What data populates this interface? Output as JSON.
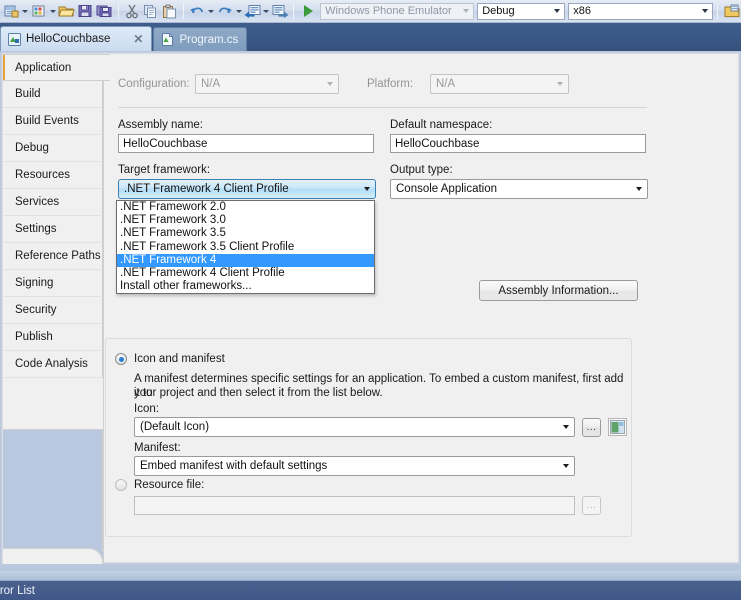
{
  "toolbar": {
    "icons": [
      "new-project-icon",
      "new-item-icon",
      "open-file-icon",
      "save-icon",
      "save-all-icon",
      "cut-icon",
      "copy-icon",
      "paste-icon",
      "undo-icon",
      "redo-icon",
      "navigate-backward-icon",
      "navigate-forward-icon",
      "start-debugging-icon",
      "solution-explorer-icon"
    ],
    "target_device": {
      "value": "Windows Phone Emulator",
      "disabled": true
    },
    "configuration": {
      "value": "Debug"
    },
    "platform": {
      "value": "x86"
    }
  },
  "tabs": [
    {
      "label": "HelloCouchbase",
      "active": true,
      "close": "✕",
      "icon": "project-properties-icon"
    },
    {
      "label": "Program.cs",
      "active": false,
      "icon": "csharp-file-icon"
    }
  ],
  "sidebar": {
    "items": [
      {
        "label": "Application",
        "selected": true
      },
      {
        "label": "Build",
        "selected": false
      },
      {
        "label": "Build Events",
        "selected": false
      },
      {
        "label": "Debug",
        "selected": false
      },
      {
        "label": "Resources",
        "selected": false
      },
      {
        "label": "Services",
        "selected": false
      },
      {
        "label": "Settings",
        "selected": false
      },
      {
        "label": "Reference Paths",
        "selected": false
      },
      {
        "label": "Signing",
        "selected": false
      },
      {
        "label": "Security",
        "selected": false
      },
      {
        "label": "Publish",
        "selected": false
      },
      {
        "label": "Code Analysis",
        "selected": false
      }
    ]
  },
  "main": {
    "configuration": {
      "label": "Configuration:",
      "value": "N/A"
    },
    "platform": {
      "label": "Platform:",
      "value": "N/A"
    },
    "assembly_name": {
      "label": "Assembly name:",
      "value": "HelloCouchbase"
    },
    "default_namespace": {
      "label": "Default namespace:",
      "value": "HelloCouchbase"
    },
    "target_framework": {
      "label": "Target framework:",
      "value": ".NET Framework 4 Client Profile",
      "options": [
        {
          "label": ".NET Framework 2.0",
          "selected": false
        },
        {
          "label": ".NET Framework 3.0",
          "selected": false
        },
        {
          "label": ".NET Framework 3.5",
          "selected": false
        },
        {
          "label": ".NET Framework 3.5 Client Profile",
          "selected": false
        },
        {
          "label": ".NET Framework 4",
          "selected": true
        },
        {
          "label": ".NET Framework 4 Client Profile",
          "selected": false
        },
        {
          "label": "Install other frameworks...",
          "selected": false
        }
      ]
    },
    "output_type": {
      "label": "Output type:",
      "value": "Console Application"
    },
    "assembly_information_button": "Assembly Information...",
    "resources_group": {
      "icon_and_manifest": {
        "radio_label": "Icon and manifest",
        "selected": true,
        "description_line1": "A manifest determines specific settings for an application. To embed a custom manifest, first add it to",
        "description_line2": "your project and then select it from the list below.",
        "icon_label": "Icon:",
        "icon_value": "(Default Icon)",
        "browse_button": "...",
        "preview_icon": "icon-preview-thumbnail",
        "manifest_label": "Manifest:",
        "manifest_value": "Embed manifest with default settings"
      },
      "resource_file": {
        "radio_label": "Resource file:",
        "selected": false,
        "value": "",
        "browse_button": "..."
      }
    }
  },
  "statusbar": {
    "error_list_label": "rror List"
  },
  "colors": {
    "accent_orange": "#e3a33c",
    "selection_blue": "#3399ff",
    "combo_hot_border": "#3c7fb1",
    "tabstrip_bg": "#35527d",
    "panel_bg": "#f0f0f0",
    "desktop_bg": "#b9c8de"
  }
}
